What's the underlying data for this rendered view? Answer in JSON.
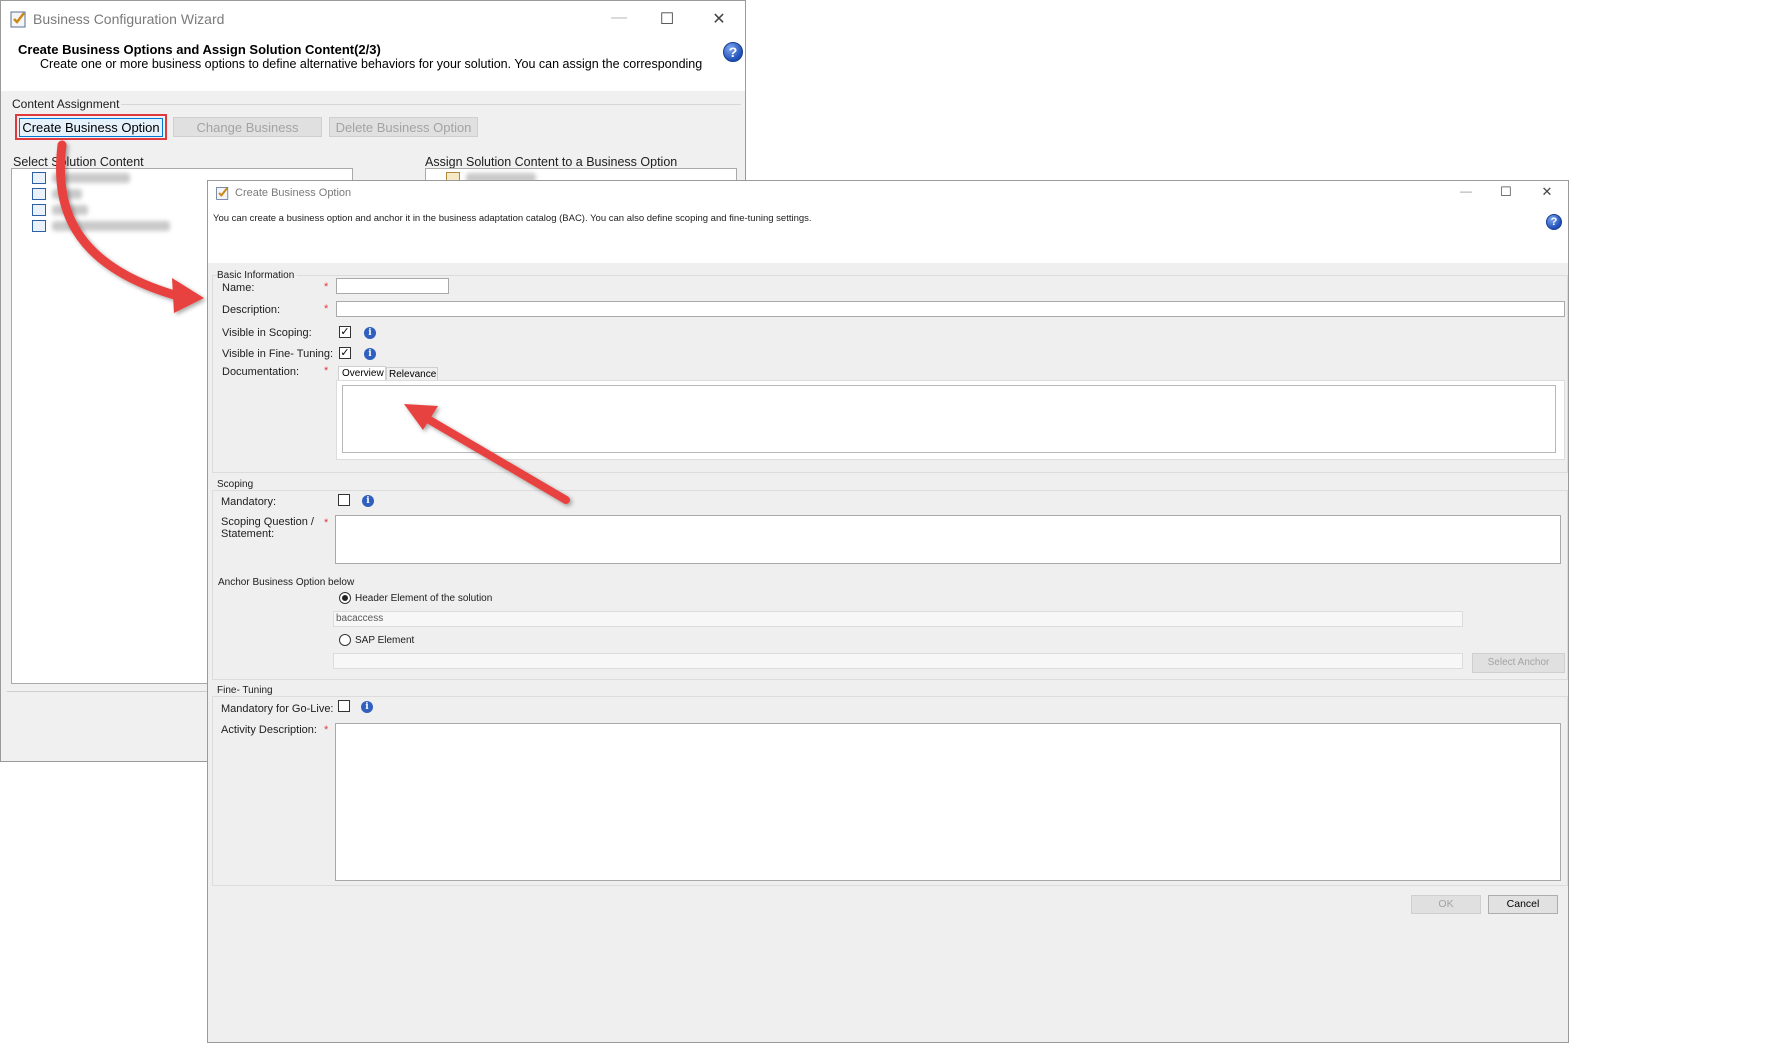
{
  "wizard": {
    "title": "Business Configuration Wizard",
    "heading": "Create Business Options and Assign Solution Content(2/3)",
    "description": "Create one or more business options to define alternative behaviors for your solution. You can assign the corresponding",
    "content_assignment_label": "Content Assignment",
    "buttons": {
      "create": "Create Business Option",
      "change": "Change Business",
      "delete": "Delete Business Option"
    },
    "select_solution_content_label": "Select Solution Content",
    "assign_content_label": "Assign Solution Content to a Business  Option"
  },
  "dialog": {
    "title": "Create Business Option",
    "intro": "You can create a business option and anchor it in the business adaptation catalog (BAC). You can also define scoping and fine-tuning settings.",
    "basic_info": {
      "section_label": "Basic Information",
      "name_label": "Name:",
      "name_value": "",
      "description_label": "Description:",
      "description_value": "",
      "visible_scoping_label": "Visible in Scoping:",
      "visible_scoping_checked": true,
      "visible_finetuning_label": "Visible in Fine- Tuning:",
      "visible_finetuning_checked": true,
      "documentation_label": "Documentation:",
      "tabs": [
        "Overview",
        "Relevance"
      ]
    },
    "scoping": {
      "section_label": "Scoping",
      "mandatory_label": "Mandatory:",
      "question_label_line1": "Scoping Question /",
      "question_label_line2": "Statement:",
      "anchor_label": "Anchor Business Option below",
      "radio_header_label": "Header Element of the solution",
      "header_value": "bacaccess",
      "radio_sap_label": "SAP Element",
      "select_anchor_button": "Select Anchor"
    },
    "finetuning": {
      "section_label": "Fine- Tuning",
      "mandatory_golive_label": "Mandatory  for Go-Live:",
      "activity_description_label": "Activity Description:"
    },
    "ok_button": "OK",
    "cancel_button": "Cancel"
  },
  "window_controls": {
    "minimize": "—",
    "maximize": "☐",
    "close": "✕"
  },
  "required_marker": "*",
  "icons": {
    "help": "?",
    "info": "i",
    "check": "✓"
  },
  "colors": {
    "highlight_border": "#e0393e",
    "arrow": "#e8423f",
    "help_blue": "#1e4fb8"
  }
}
